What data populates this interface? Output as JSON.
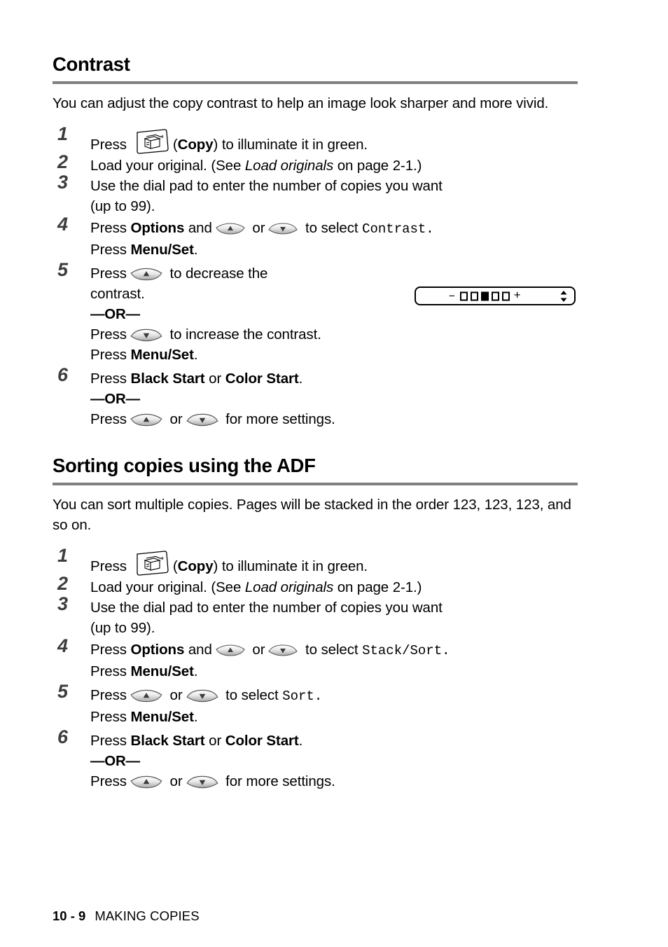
{
  "document": {
    "footer": {
      "page_number": "10 - 9",
      "section": "MAKING COPIES"
    }
  },
  "sections": [
    {
      "id": "contrast",
      "heading": "Contrast",
      "intro": "You can adjust the copy contrast to help an image look sharper and more vivid.",
      "steps": [
        {
          "number": "1",
          "parts": {
            "press": "Press",
            "icon": "copy-button-icon",
            "open_paren": "(",
            "button": "Copy",
            "tail": ") to illuminate it in green."
          }
        },
        {
          "number": "2",
          "parts": {
            "lead": "Load your original. (See ",
            "ref": "Load originals",
            "tail": " on page 2-1.)"
          }
        },
        {
          "number": "3",
          "parts": {
            "line1": "Use the dial pad to enter the number of copies you want",
            "line2": "(up to 99)."
          }
        },
        {
          "number": "4",
          "parts": {
            "press": "Press",
            "options": "Options",
            "and": "and",
            "or": "or",
            "to_select": "to select",
            "value": "Contrast.",
            "press2": "Press",
            "menuset": "Menu/Set",
            "period": "."
          }
        },
        {
          "number": "5",
          "parts": {
            "press": "Press",
            "decrease_1": "to decrease the",
            "decrease_2": "contrast.",
            "or_divider": "—OR—",
            "press2": "Press",
            "increase": "to increase the contrast.",
            "press3": "Press",
            "menuset": "Menu/Set",
            "period": "."
          }
        },
        {
          "number": "6",
          "parts": {
            "press": "Press",
            "black_start": "Black Start",
            "or": "or",
            "color_start": "Color Start",
            "period": ".",
            "or_divider": "—OR—",
            "press2": "Press",
            "or2": "or",
            "more_settings": "for more settings."
          }
        }
      ],
      "lcd": {
        "minus": "–",
        "plus": "+",
        "segments": [
          "empty",
          "empty",
          "filled",
          "empty",
          "empty"
        ],
        "scroll_indicator": "up-down-arrow-icon"
      }
    },
    {
      "id": "sorting-copies-adf",
      "heading": "Sorting copies using the ADF",
      "intro": "You can sort multiple copies. Pages will be stacked in the order 123, 123, 123, and so on.",
      "steps": [
        {
          "number": "1",
          "parts": {
            "press": "Press",
            "icon": "copy-button-icon",
            "open_paren": "(",
            "button": "Copy",
            "tail": ") to illuminate it in green."
          }
        },
        {
          "number": "2",
          "parts": {
            "lead": "Load your original. (See ",
            "ref": "Load originals",
            "tail": " on page 2-1.)"
          }
        },
        {
          "number": "3",
          "parts": {
            "line1": "Use the dial pad to enter the number of copies you want",
            "line2": "(up to 99)."
          }
        },
        {
          "number": "4",
          "parts": {
            "press": "Press",
            "options": "Options",
            "and": "and",
            "or": "or",
            "to_select": "to select",
            "value": "Stack/Sort.",
            "press2": "Press",
            "menuset": "Menu/Set",
            "period": "."
          }
        },
        {
          "number": "5",
          "parts": {
            "press": "Press",
            "or": "or",
            "to_select": "to select",
            "value": "Sort.",
            "press2": "Press",
            "menuset": "Menu/Set",
            "period": "."
          }
        },
        {
          "number": "6",
          "parts": {
            "press": "Press",
            "black_start": "Black Start",
            "or": "or",
            "color_start": "Color Start",
            "period": ".",
            "or_divider": "—OR—",
            "press2": "Press",
            "or2": "or",
            "more_settings": "for more settings."
          }
        }
      ]
    }
  ]
}
